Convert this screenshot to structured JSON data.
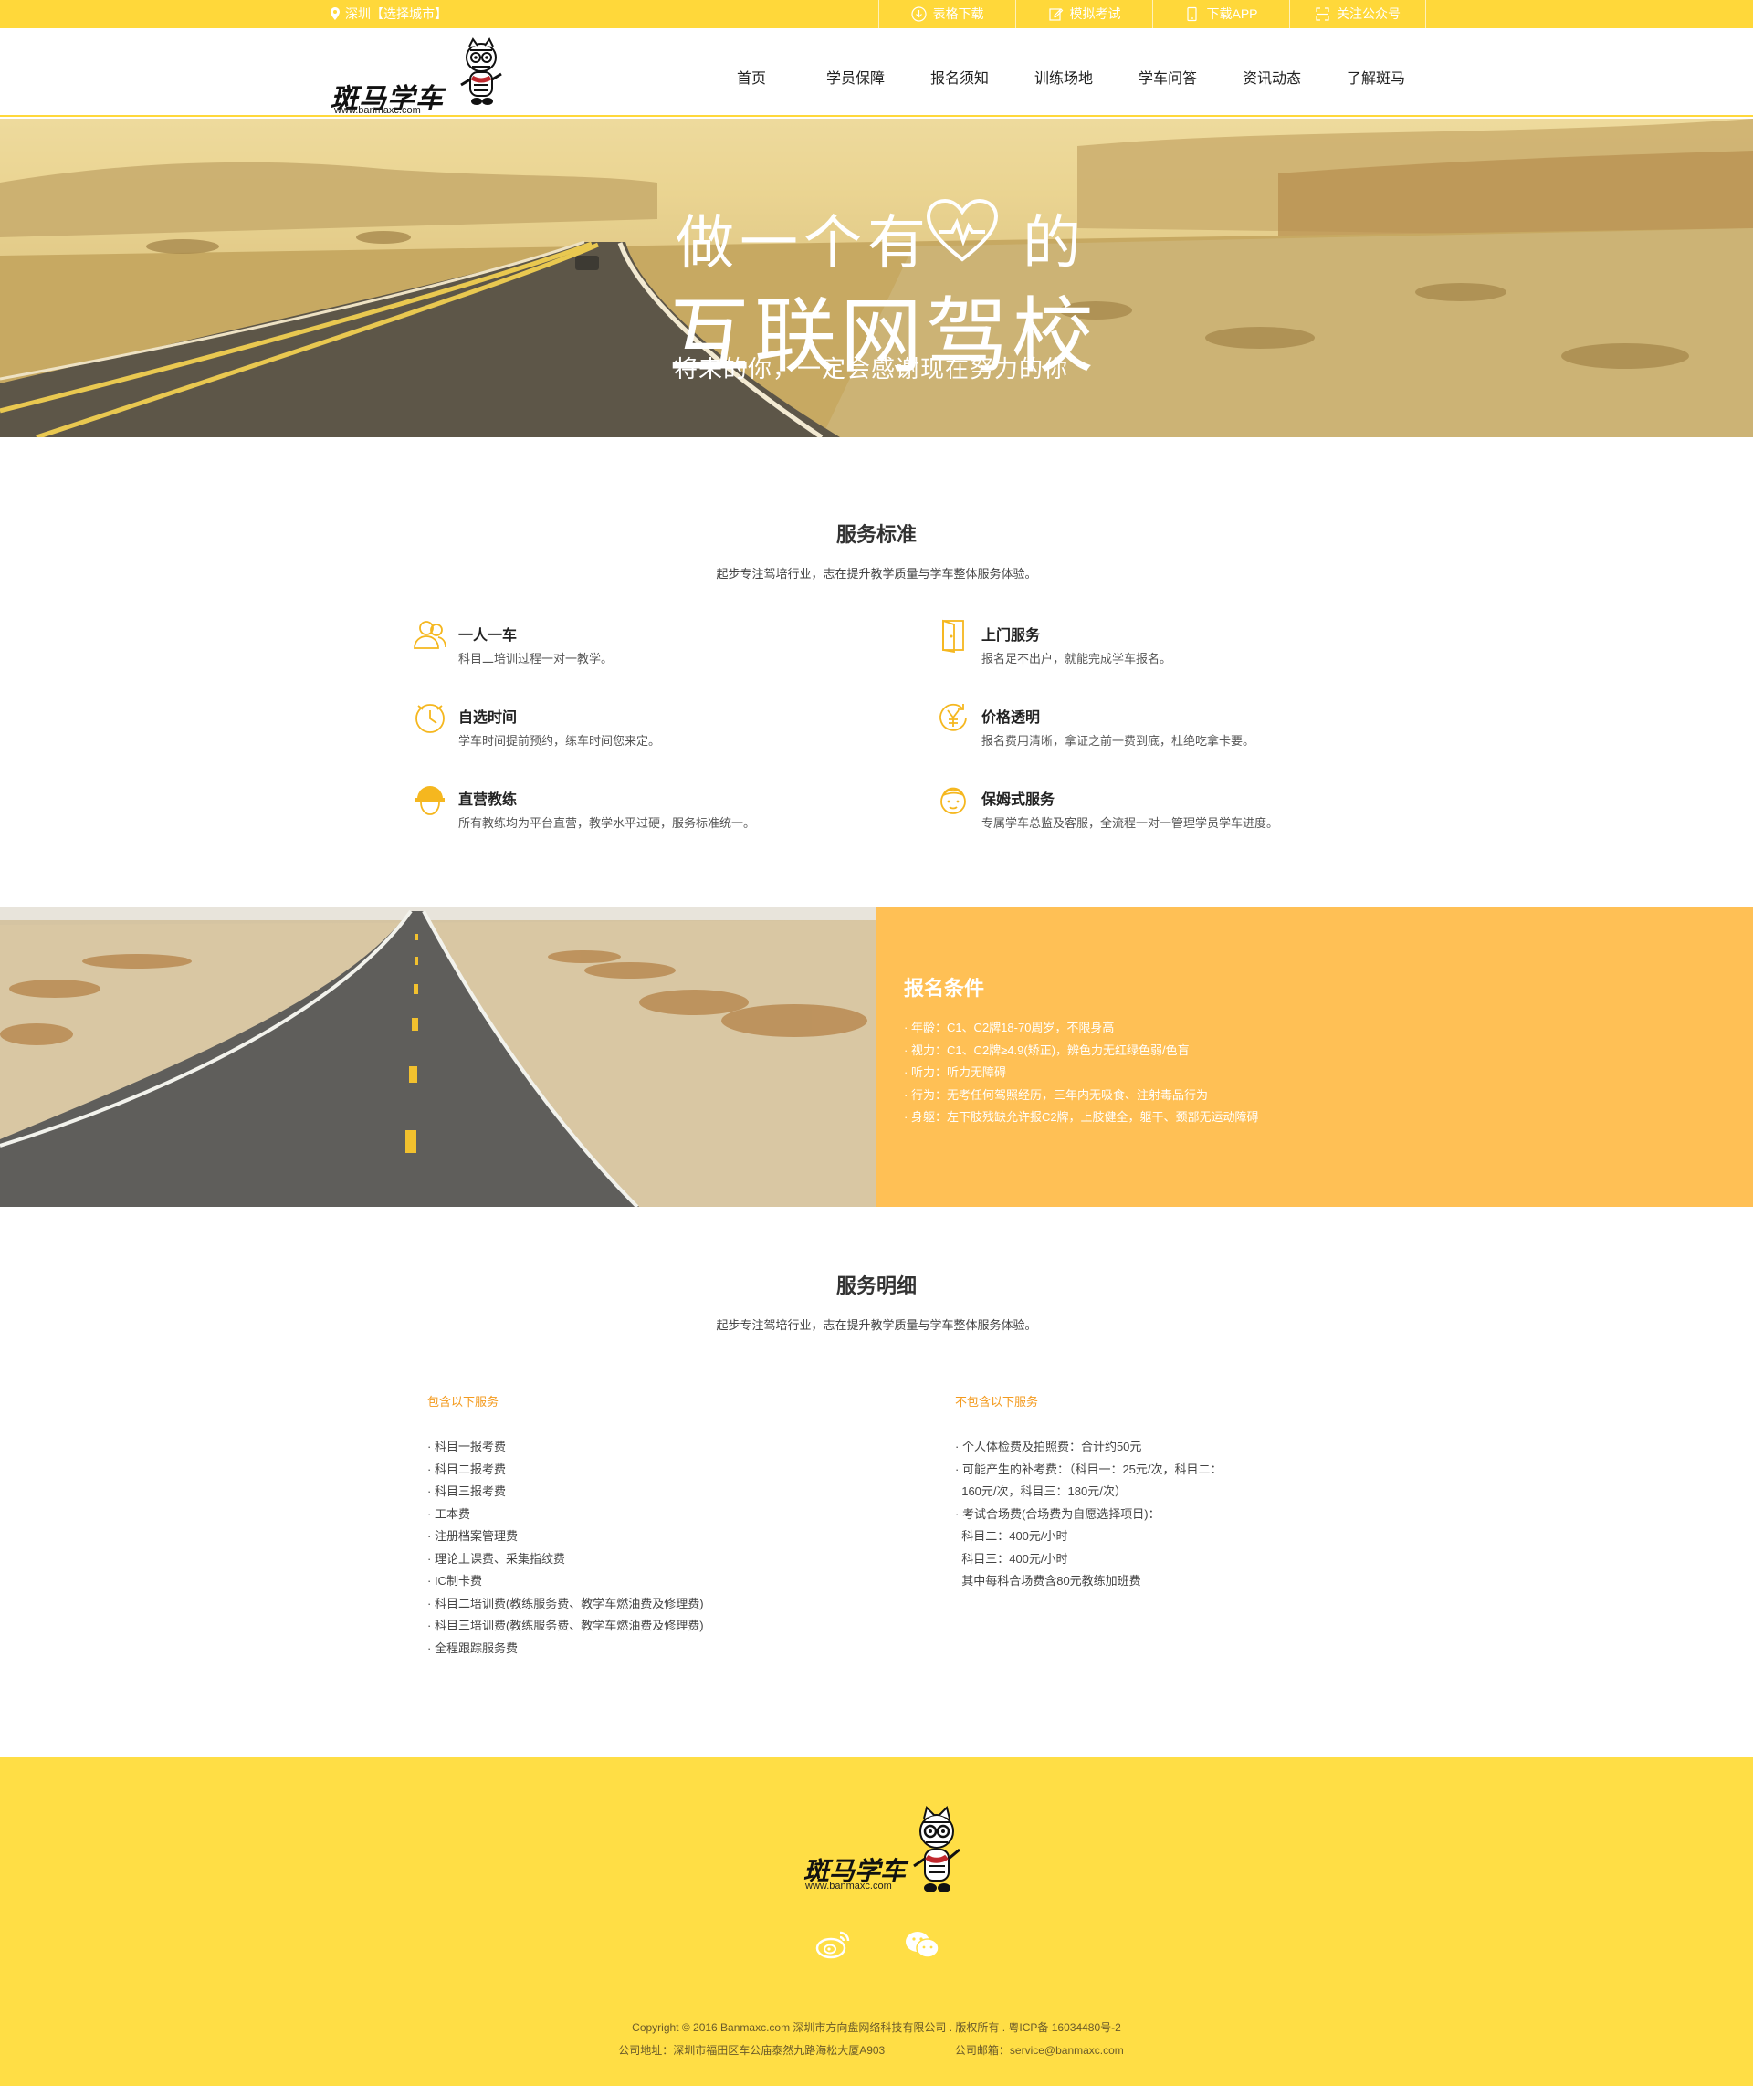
{
  "colors": {
    "brand_yellow": "#ffd83a",
    "footer_yellow": "#ffde45",
    "orange_panel": "#ffc055",
    "accent_orange": "#f39a1e"
  },
  "topbar": {
    "city": "深圳【选择城市】",
    "links": [
      {
        "label": "表格下载",
        "icon": "download-icon"
      },
      {
        "label": "模拟考试",
        "icon": "edit-icon"
      },
      {
        "label": "下载APP",
        "icon": "phone-icon"
      },
      {
        "label": "关注公众号",
        "icon": "qr-icon"
      }
    ]
  },
  "header": {
    "brand": "斑马学车",
    "url": "www.banmaxc.com",
    "nav": [
      "首页",
      "学员保障",
      "报名须知",
      "训练场地",
      "学车问答",
      "资讯动态",
      "了解斑马"
    ]
  },
  "banner": {
    "line1_a": "做一个有",
    "line1_b": "的",
    "line2": "互联网驾校",
    "line3": "将来的你，一定会感谢现在努力的你"
  },
  "standards": {
    "title": "服务标准",
    "subtitle": "起步专注驾培行业，志在提升教学质量与学车整体服务体验。",
    "items": [
      {
        "title": "一人一车",
        "desc": "科目二培训过程一对一教学。",
        "icon": "users-icon"
      },
      {
        "title": "上门服务",
        "desc": "报名足不出户，就能完成学车报名。",
        "icon": "door-icon"
      },
      {
        "title": "自选时间",
        "desc": "学车时间提前预约，练车时间您来定。",
        "icon": "clock-icon"
      },
      {
        "title": "价格透明",
        "desc": "报名费用清晰，拿证之前一费到底，杜绝吃拿卡要。",
        "icon": "yuan-icon"
      },
      {
        "title": "直营教练",
        "desc": "所有教练均为平台直营，教学水平过硬，服务标准统一。",
        "icon": "coach-icon"
      },
      {
        "title": "保姆式服务",
        "desc": "专属学车总监及客服，全流程一对一管理学员学车进度。",
        "icon": "nanny-icon"
      }
    ]
  },
  "conditions": {
    "title": "报名条件",
    "items": [
      "· 年龄：C1、C2牌18-70周岁，不限身高",
      "· 视力：C1、C2牌≥4.9(矫正)，辨色力无红绿色弱/色盲",
      "· 听力：听力无障碍",
      "· 行为：无考任何驾照经历，三年内无吸食、注射毒品行为",
      "· 身躯：左下肢残缺允许报C2牌，上肢健全，躯干、颈部无运动障碍"
    ]
  },
  "details": {
    "title": "服务明细",
    "subtitle": "起步专注驾培行业，志在提升教学质量与学车整体服务体验。",
    "included_title": "包含以下服务",
    "included": [
      "· 科目一报考费",
      "· 科目二报考费",
      "· 科目三报考费",
      "· 工本费",
      "· 注册档案管理费",
      "· 理论上课费、采集指纹费",
      "· IC制卡费",
      "· 科目二培训费(教练服务费、教学车燃油费及修理费)",
      "· 科目三培训费(教练服务费、教学车燃油费及修理费)",
      "· 全程跟踪服务费"
    ],
    "excluded_title": "不包含以下服务",
    "excluded": [
      "· 个人体检费及拍照费：合计约50元",
      "· 可能产生的补考费：（科目一：25元/次，科目二：",
      "  160元/次，科目三：180元/次）",
      "· 考试合场费(合场费为自愿选择项目)：",
      "  科目二：400元/小时",
      "  科目三：400元/小时",
      "  其中每科合场费含80元教练加班费"
    ]
  },
  "footer": {
    "brand": "斑马学车",
    "url": "www.banmaxc.com",
    "social": [
      "weibo-icon",
      "wechat-icon"
    ],
    "copyright": "Copyright © 2016 Banmaxc.com    深圳市方向盘网络科技有限公司 . 版权所有 . 粤ICP备 16034480号-2",
    "address": "公司地址：深圳市福田区车公庙泰然九路海松大厦A903",
    "email": "公司邮箱：service@banmaxc.com"
  }
}
